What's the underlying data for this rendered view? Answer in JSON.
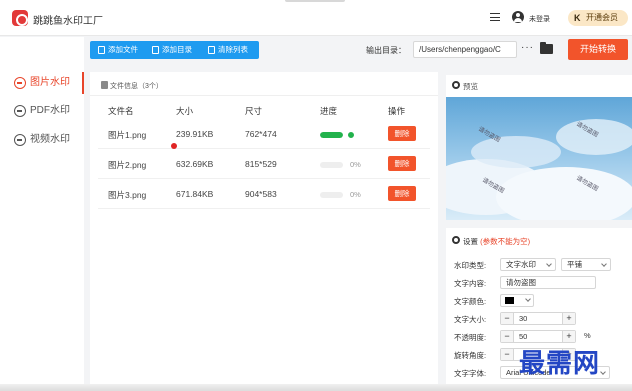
{
  "window": {
    "app_title": "跳跳鱼水印工厂"
  },
  "header": {
    "login_label": "未登录",
    "vip_label": "开通会员",
    "vip_icon": "K"
  },
  "sidebar": {
    "items": [
      {
        "label": "图片水印",
        "active": true
      },
      {
        "label": "PDF水印",
        "active": false
      },
      {
        "label": "视频水印",
        "active": false
      }
    ]
  },
  "toolbar": {
    "add_file": "添加文件",
    "add_dir": "添加目录",
    "clear_list": "清除列表",
    "output_label": "输出目录：",
    "output_path": "/Users/chenpenggao/C",
    "more": "···",
    "start": "开始转换"
  },
  "files": {
    "title": "文件信息（3个）",
    "columns": {
      "name": "文件名",
      "size": "大小",
      "dims": "尺寸",
      "progress": "进度",
      "action": "操作"
    },
    "rows": [
      {
        "name": "图片1.png",
        "size": "239.91KB",
        "dims": "762*474",
        "progress": 1.0,
        "pct": "",
        "action": "删除"
      },
      {
        "name": "图片2.png",
        "size": "632.69KB",
        "dims": "815*529",
        "progress": 0,
        "pct": "0%",
        "action": "删除"
      },
      {
        "name": "图片3.png",
        "size": "671.84KB",
        "dims": "904*583",
        "progress": 0,
        "pct": "0%",
        "action": "删除"
      }
    ]
  },
  "preview": {
    "title": "预览",
    "watermark_text": "请勿盗图"
  },
  "settings": {
    "title": "设置",
    "note": "(参数不能为空)",
    "type_label": "水印类型:",
    "type_value": "文字水印",
    "tile_value": "平铺",
    "text_label": "文字内容:",
    "text_value": "请勿盗图",
    "color_label": "文字颜色:",
    "color_value": "#000000",
    "size_label": "文字大小:",
    "size_value": "30",
    "opacity_label": "不透明度:",
    "opacity_value": "50",
    "opacity_unit": "%",
    "rotate_label": "旋转角度:",
    "font_label": "文字字体:",
    "font_value": "Arial Unicode"
  },
  "overlay": {
    "site_mark": "最需网"
  },
  "colors": {
    "accent": "#f2542b",
    "primary": "#1e9bf0",
    "success": "#22b24c",
    "vip_bg": "#fbe7c6"
  }
}
